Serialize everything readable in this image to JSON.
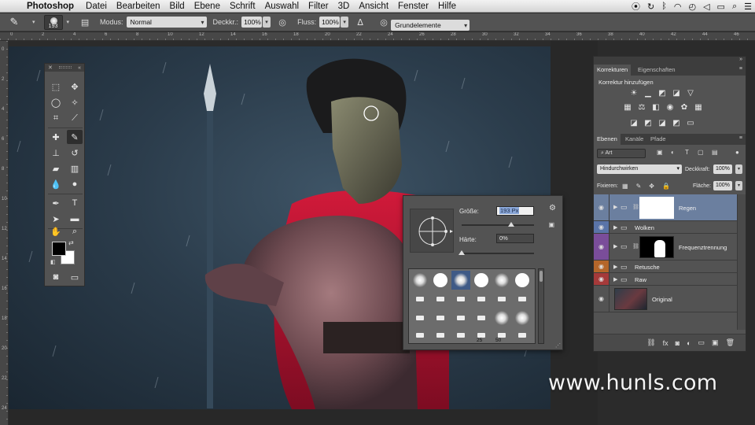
{
  "menubar": {
    "app": "Photoshop",
    "items": [
      "Datei",
      "Bearbeiten",
      "Bild",
      "Ebene",
      "Schrift",
      "Auswahl",
      "Filter",
      "3D",
      "Ansicht",
      "Fenster",
      "Hilfe"
    ]
  },
  "options": {
    "brush_size": "193",
    "mode_label": "Modus:",
    "mode_value": "Normal",
    "opacity_label": "Deckkr.:",
    "opacity_value": "100%",
    "flow_label": "Fluss:",
    "flow_value": "100%",
    "workspace": "Grundelemente"
  },
  "ruler_top": [
    "0",
    "2",
    "4",
    "6",
    "8",
    "10",
    "12",
    "14",
    "16",
    "18",
    "20",
    "22",
    "24",
    "26",
    "28",
    "30",
    "32",
    "34",
    "36",
    "38",
    "40",
    "42",
    "44",
    "46"
  ],
  "ruler_left": [
    "0",
    "2",
    "4",
    "6",
    "8",
    "10",
    "12",
    "14",
    "16",
    "18",
    "20",
    "22",
    "24"
  ],
  "brush_picker": {
    "size_label": "Größe:",
    "size_value": "193 Px",
    "size_fraction": 0.68,
    "hardness_label": "Härte:",
    "hardness_value": "0%",
    "hardness_fraction": 0.0,
    "tip_numbers": [
      "25",
      "50"
    ]
  },
  "watermark": "www.hunls.com",
  "panels": {
    "adjustments": {
      "tabs": [
        "Korrekturen",
        "Eigenschaften"
      ],
      "title": "Korrektur hinzufügen"
    },
    "layers": {
      "tabs": [
        "Ebenen",
        "Kanäle",
        "Pfade"
      ],
      "filter": "Art",
      "blend_mode": "Hindurchwirken",
      "opacity_label": "Deckkraft:",
      "opacity_value": "100%",
      "lock_label": "Fixieren:",
      "fill_label": "Fläche:",
      "fill_value": "100%",
      "items": [
        {
          "name": "Regen",
          "color": "#6b7f9f",
          "selected": true
        },
        {
          "name": "Wolken",
          "color": "#5a74a8"
        },
        {
          "name": "Frequenztrennung",
          "color": "#7a4d9a"
        },
        {
          "name": "Retusche",
          "color": "#b4662a"
        },
        {
          "name": "Raw",
          "color": "#a53a3a"
        },
        {
          "name": "Original",
          "color": ""
        }
      ]
    }
  },
  "colors": {
    "foreground": "#000000",
    "background": "#ffffff",
    "selection": "#6b7f9f"
  }
}
